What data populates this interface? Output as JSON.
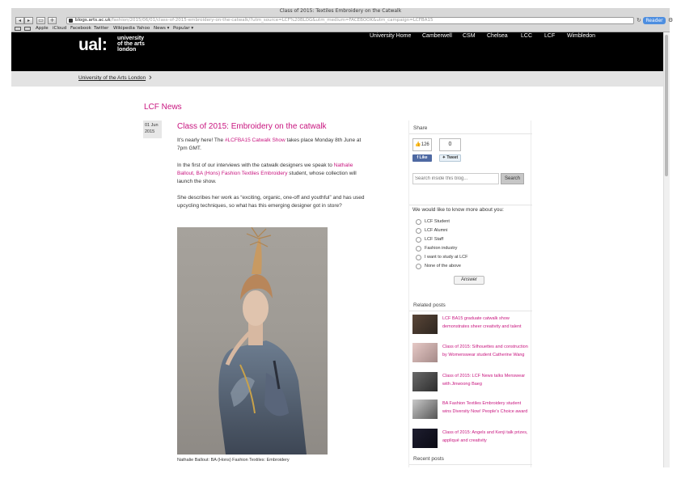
{
  "browser": {
    "window_title": "Class of 2015: Textiles Embroidery on the Catwalk",
    "url_host": "blogs.arts.ac.uk",
    "url_path": "/fashion/2015/06/01/class-of-2015-embroidery-on-the-catwalk/?utm_source=LCF%20BLOG&utm_medium=FACEBOOK&utm_campaign=LCFBA15",
    "reader_label": "Reader",
    "bookmarks": [
      "Apple",
      "iCloud",
      "Facebook",
      "Twitter",
      "Wikipedia",
      "Yahoo",
      "News ▾",
      "Popular ▾"
    ]
  },
  "header": {
    "logo_mark": "ual:",
    "logo_lines": [
      "university",
      "of the arts",
      "london"
    ],
    "nav": [
      "University Home",
      "Camberwell",
      "CSM",
      "Chelsea",
      "LCC",
      "LCF",
      "Wimbledon"
    ],
    "background": "#000000"
  },
  "breadcrumb": {
    "label": "University of the Arts London"
  },
  "main": {
    "section_title": "LCF News",
    "date_day_month": "01 Jun",
    "date_year": "2015",
    "post_title": "Class of 2015: Embroidery on the catwalk",
    "p1_a": "It's nearly here! The ",
    "p1_link": "#LCFBA15 Catwalk Show",
    "p1_b": " takes place Monday 8th June at 7pm GMT.",
    "p2_a": "In the first of our interviews with the catwalk designers we speak to ",
    "p2_link": "Nathalie Ballout, BA (Hons) Fashion Textiles Embroidery",
    "p2_b": " student, whose collection will launch the show.",
    "p3": "She describes her work as “exciting, organic, one-off and youthful” and has used upcycling techniques, so what has this emerging designer got in store?",
    "caption": "Nathalie Ballout: BA (Hons) Fashion Textiles: Embroidery",
    "accent_color": "#c8157f"
  },
  "sidebar": {
    "share_heading": "Share",
    "like_count": "126",
    "like_label": "Like",
    "share_count": "0",
    "tweet_label": "Tweet",
    "search_placeholder": "Search inside this blog...",
    "search_button": "Search",
    "poll_question": "We would like to know more about you:",
    "poll_options": [
      "LCF Student",
      "LCF Alumni",
      "LCF Staff",
      "Fashion industry",
      "I want to study at LCF",
      "None of the above"
    ],
    "answer_button": "Answer",
    "related_heading": "Related posts",
    "related_posts": [
      "LCF BA15 graduate catwalk show demonstrates sheer creativity and talent",
      "Class of 2015: Silhouettes and construction by Womenswear student Catherine Wang",
      "Class of 2015: LCF News talks Menswear with Jinwoong Baeg",
      "BA Fashion Textiles Embroidery student wins Diversity Now! People's Choice award",
      "Class of 2015: Angels and Kenji talk prizes, appliqué and creativity"
    ],
    "recent_heading": "Recent posts"
  }
}
